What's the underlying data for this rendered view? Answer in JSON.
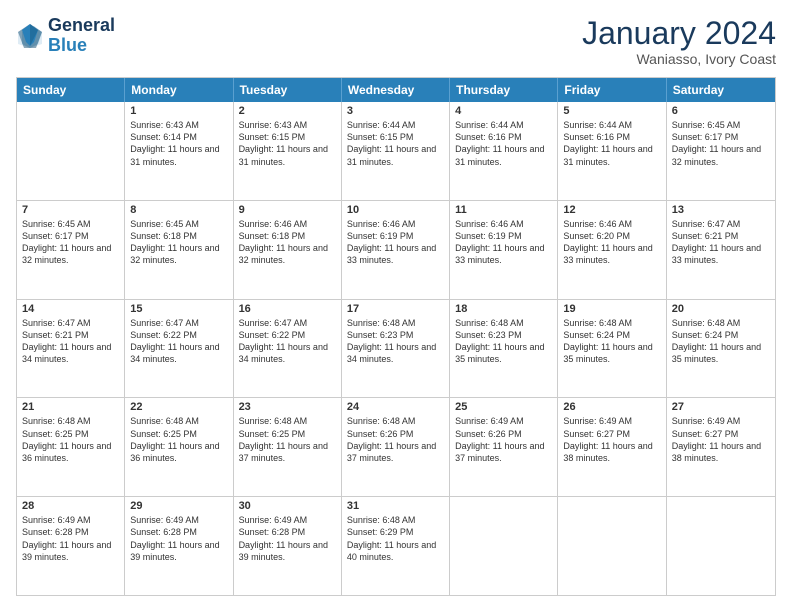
{
  "logo": {
    "line1": "General",
    "line2": "Blue"
  },
  "title": "January 2024",
  "subtitle": "Waniasso, Ivory Coast",
  "header": {
    "days": [
      "Sunday",
      "Monday",
      "Tuesday",
      "Wednesday",
      "Thursday",
      "Friday",
      "Saturday"
    ]
  },
  "weeks": [
    [
      {
        "day": "",
        "sunrise": "",
        "sunset": "",
        "daylight": ""
      },
      {
        "day": "1",
        "sunrise": "Sunrise: 6:43 AM",
        "sunset": "Sunset: 6:14 PM",
        "daylight": "Daylight: 11 hours and 31 minutes."
      },
      {
        "day": "2",
        "sunrise": "Sunrise: 6:43 AM",
        "sunset": "Sunset: 6:15 PM",
        "daylight": "Daylight: 11 hours and 31 minutes."
      },
      {
        "day": "3",
        "sunrise": "Sunrise: 6:44 AM",
        "sunset": "Sunset: 6:15 PM",
        "daylight": "Daylight: 11 hours and 31 minutes."
      },
      {
        "day": "4",
        "sunrise": "Sunrise: 6:44 AM",
        "sunset": "Sunset: 6:16 PM",
        "daylight": "Daylight: 11 hours and 31 minutes."
      },
      {
        "day": "5",
        "sunrise": "Sunrise: 6:44 AM",
        "sunset": "Sunset: 6:16 PM",
        "daylight": "Daylight: 11 hours and 31 minutes."
      },
      {
        "day": "6",
        "sunrise": "Sunrise: 6:45 AM",
        "sunset": "Sunset: 6:17 PM",
        "daylight": "Daylight: 11 hours and 32 minutes."
      }
    ],
    [
      {
        "day": "7",
        "sunrise": "Sunrise: 6:45 AM",
        "sunset": "Sunset: 6:17 PM",
        "daylight": "Daylight: 11 hours and 32 minutes."
      },
      {
        "day": "8",
        "sunrise": "Sunrise: 6:45 AM",
        "sunset": "Sunset: 6:18 PM",
        "daylight": "Daylight: 11 hours and 32 minutes."
      },
      {
        "day": "9",
        "sunrise": "Sunrise: 6:46 AM",
        "sunset": "Sunset: 6:18 PM",
        "daylight": "Daylight: 11 hours and 32 minutes."
      },
      {
        "day": "10",
        "sunrise": "Sunrise: 6:46 AM",
        "sunset": "Sunset: 6:19 PM",
        "daylight": "Daylight: 11 hours and 33 minutes."
      },
      {
        "day": "11",
        "sunrise": "Sunrise: 6:46 AM",
        "sunset": "Sunset: 6:19 PM",
        "daylight": "Daylight: 11 hours and 33 minutes."
      },
      {
        "day": "12",
        "sunrise": "Sunrise: 6:46 AM",
        "sunset": "Sunset: 6:20 PM",
        "daylight": "Daylight: 11 hours and 33 minutes."
      },
      {
        "day": "13",
        "sunrise": "Sunrise: 6:47 AM",
        "sunset": "Sunset: 6:21 PM",
        "daylight": "Daylight: 11 hours and 33 minutes."
      }
    ],
    [
      {
        "day": "14",
        "sunrise": "Sunrise: 6:47 AM",
        "sunset": "Sunset: 6:21 PM",
        "daylight": "Daylight: 11 hours and 34 minutes."
      },
      {
        "day": "15",
        "sunrise": "Sunrise: 6:47 AM",
        "sunset": "Sunset: 6:22 PM",
        "daylight": "Daylight: 11 hours and 34 minutes."
      },
      {
        "day": "16",
        "sunrise": "Sunrise: 6:47 AM",
        "sunset": "Sunset: 6:22 PM",
        "daylight": "Daylight: 11 hours and 34 minutes."
      },
      {
        "day": "17",
        "sunrise": "Sunrise: 6:48 AM",
        "sunset": "Sunset: 6:23 PM",
        "daylight": "Daylight: 11 hours and 34 minutes."
      },
      {
        "day": "18",
        "sunrise": "Sunrise: 6:48 AM",
        "sunset": "Sunset: 6:23 PM",
        "daylight": "Daylight: 11 hours and 35 minutes."
      },
      {
        "day": "19",
        "sunrise": "Sunrise: 6:48 AM",
        "sunset": "Sunset: 6:24 PM",
        "daylight": "Daylight: 11 hours and 35 minutes."
      },
      {
        "day": "20",
        "sunrise": "Sunrise: 6:48 AM",
        "sunset": "Sunset: 6:24 PM",
        "daylight": "Daylight: 11 hours and 35 minutes."
      }
    ],
    [
      {
        "day": "21",
        "sunrise": "Sunrise: 6:48 AM",
        "sunset": "Sunset: 6:25 PM",
        "daylight": "Daylight: 11 hours and 36 minutes."
      },
      {
        "day": "22",
        "sunrise": "Sunrise: 6:48 AM",
        "sunset": "Sunset: 6:25 PM",
        "daylight": "Daylight: 11 hours and 36 minutes."
      },
      {
        "day": "23",
        "sunrise": "Sunrise: 6:48 AM",
        "sunset": "Sunset: 6:25 PM",
        "daylight": "Daylight: 11 hours and 37 minutes."
      },
      {
        "day": "24",
        "sunrise": "Sunrise: 6:48 AM",
        "sunset": "Sunset: 6:26 PM",
        "daylight": "Daylight: 11 hours and 37 minutes."
      },
      {
        "day": "25",
        "sunrise": "Sunrise: 6:49 AM",
        "sunset": "Sunset: 6:26 PM",
        "daylight": "Daylight: 11 hours and 37 minutes."
      },
      {
        "day": "26",
        "sunrise": "Sunrise: 6:49 AM",
        "sunset": "Sunset: 6:27 PM",
        "daylight": "Daylight: 11 hours and 38 minutes."
      },
      {
        "day": "27",
        "sunrise": "Sunrise: 6:49 AM",
        "sunset": "Sunset: 6:27 PM",
        "daylight": "Daylight: 11 hours and 38 minutes."
      }
    ],
    [
      {
        "day": "28",
        "sunrise": "Sunrise: 6:49 AM",
        "sunset": "Sunset: 6:28 PM",
        "daylight": "Daylight: 11 hours and 39 minutes."
      },
      {
        "day": "29",
        "sunrise": "Sunrise: 6:49 AM",
        "sunset": "Sunset: 6:28 PM",
        "daylight": "Daylight: 11 hours and 39 minutes."
      },
      {
        "day": "30",
        "sunrise": "Sunrise: 6:49 AM",
        "sunset": "Sunset: 6:28 PM",
        "daylight": "Daylight: 11 hours and 39 minutes."
      },
      {
        "day": "31",
        "sunrise": "Sunrise: 6:48 AM",
        "sunset": "Sunset: 6:29 PM",
        "daylight": "Daylight: 11 hours and 40 minutes."
      },
      {
        "day": "",
        "sunrise": "",
        "sunset": "",
        "daylight": ""
      },
      {
        "day": "",
        "sunrise": "",
        "sunset": "",
        "daylight": ""
      },
      {
        "day": "",
        "sunrise": "",
        "sunset": "",
        "daylight": ""
      }
    ]
  ]
}
